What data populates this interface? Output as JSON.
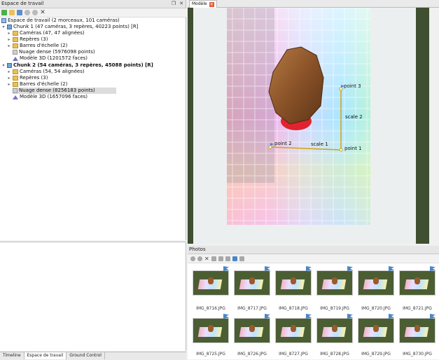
{
  "workspace": {
    "title": "Espace de travail",
    "window_buttons": [
      "❐",
      "✕"
    ],
    "tree": {
      "root": "Espace de travail (2 morceaux, 101 caméras)",
      "chunk1": {
        "label": "Chunk 1 (47 caméras, 3 repères, 40223 points) [R]",
        "items": [
          "Caméras (47, 47 alignées)",
          "Repères (3)",
          "Barres d'échelle (2)",
          "Nuage dense (5976098 points)",
          "Modèle 3D (1201572 faces)"
        ]
      },
      "chunk2": {
        "label": "Chunk 2 (54 caméras, 3 repères, 45088 points) [R]",
        "items": [
          "Caméras (54, 54 alignées)",
          "Repères (3)",
          "Barres d'échelle (2)",
          "Nuage dense (8256183 points)",
          "Modèle 3D (1657096 faces)"
        ]
      }
    }
  },
  "bottom_tabs": [
    "Timeline",
    "Espace de travail",
    "Ground Control"
  ],
  "model": {
    "tab_label": "Modèle",
    "close_glyph": "✕",
    "markers": [
      "point 1",
      "point 2",
      "point 3"
    ],
    "scale_bars": [
      "scale 1",
      "scale 2"
    ]
  },
  "photos": {
    "title": "Photos",
    "thumbnails": [
      "IMG_8716.JPG",
      "IMG_8717.JPG",
      "IMG_8718.JPG",
      "IMG_8719.JPG",
      "IMG_8720.JPG",
      "IMG_8721.JPG",
      "IMG_8725.JPG",
      "IMG_8726.JPG",
      "IMG_8727.JPG",
      "IMG_8728.JPG",
      "IMG_8729.JPG",
      "IMG_8730.JPG"
    ]
  },
  "colors": {
    "marker_line": "#d4a017",
    "model_tab_close": "#e25a3a",
    "flag": "#4a86c8"
  },
  "icons": [
    "new-icon",
    "open-icon",
    "save-icon",
    "circle-icon",
    "delete-icon",
    "flag-icon",
    "folder-icon",
    "camera-icon",
    "dense-cloud-icon",
    "model-icon"
  ]
}
